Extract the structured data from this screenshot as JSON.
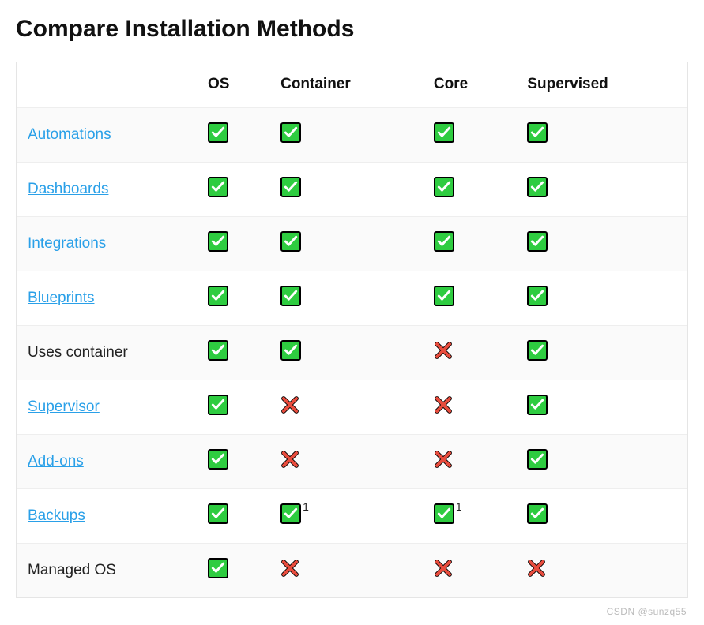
{
  "title": "Compare Installation Methods",
  "columns": [
    "",
    "OS",
    "Container",
    "Core",
    "Supervised"
  ],
  "rows": [
    {
      "label": "Automations",
      "link": true,
      "cells": [
        {
          "v": "y"
        },
        {
          "v": "y"
        },
        {
          "v": "y"
        },
        {
          "v": "y"
        }
      ]
    },
    {
      "label": "Dashboards",
      "link": true,
      "cells": [
        {
          "v": "y"
        },
        {
          "v": "y"
        },
        {
          "v": "y"
        },
        {
          "v": "y"
        }
      ]
    },
    {
      "label": "Integrations",
      "link": true,
      "cells": [
        {
          "v": "y"
        },
        {
          "v": "y"
        },
        {
          "v": "y"
        },
        {
          "v": "y"
        }
      ]
    },
    {
      "label": "Blueprints",
      "link": true,
      "cells": [
        {
          "v": "y"
        },
        {
          "v": "y"
        },
        {
          "v": "y"
        },
        {
          "v": "y"
        }
      ]
    },
    {
      "label": "Uses container",
      "link": false,
      "cells": [
        {
          "v": "y"
        },
        {
          "v": "y"
        },
        {
          "v": "n"
        },
        {
          "v": "y"
        }
      ]
    },
    {
      "label": "Supervisor",
      "link": true,
      "cells": [
        {
          "v": "y"
        },
        {
          "v": "n"
        },
        {
          "v": "n"
        },
        {
          "v": "y"
        }
      ]
    },
    {
      "label": "Add-ons",
      "link": true,
      "cells": [
        {
          "v": "y"
        },
        {
          "v": "n"
        },
        {
          "v": "n"
        },
        {
          "v": "y"
        }
      ]
    },
    {
      "label": "Backups",
      "link": true,
      "cells": [
        {
          "v": "y"
        },
        {
          "v": "y",
          "note": "1"
        },
        {
          "v": "y",
          "note": "1"
        },
        {
          "v": "y"
        }
      ]
    },
    {
      "label": "Managed OS",
      "link": false,
      "cells": [
        {
          "v": "y"
        },
        {
          "v": "n"
        },
        {
          "v": "n"
        },
        {
          "v": "n"
        }
      ]
    }
  ],
  "watermark": "CSDN @sunzq55"
}
